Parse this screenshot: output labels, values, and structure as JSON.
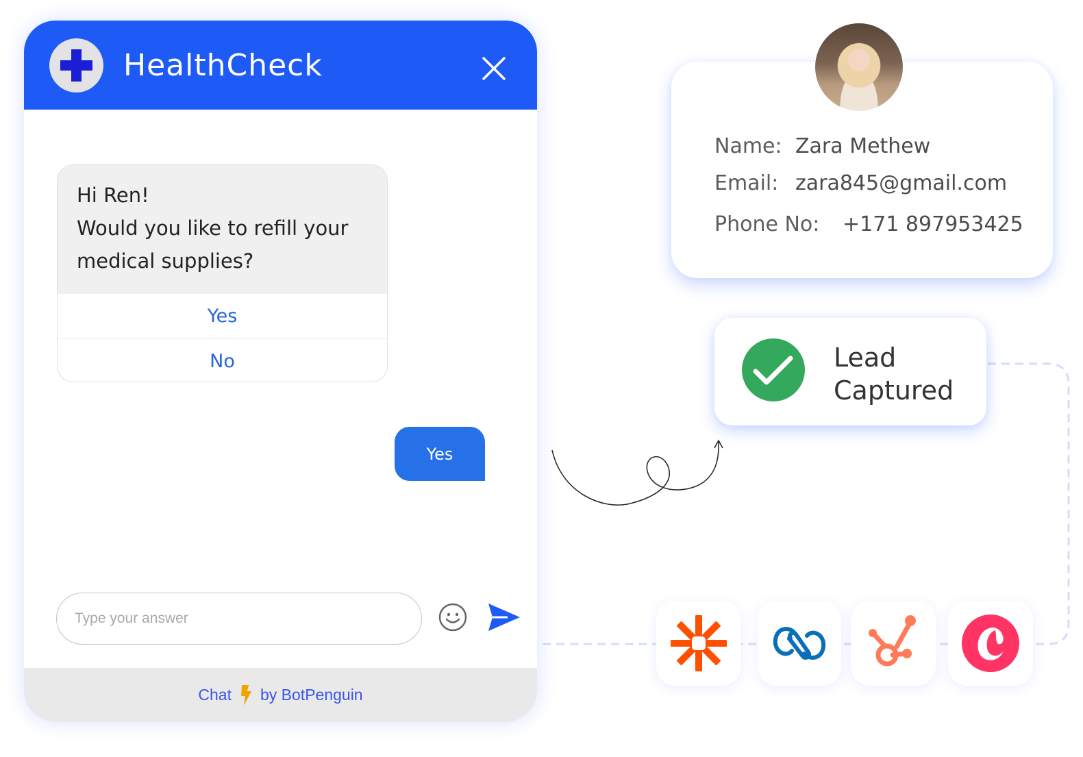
{
  "chat": {
    "title": "HealthCheck",
    "logo_icon": "medical-cross-icon",
    "close_icon": "close-icon",
    "bot_message": {
      "greeting": "Hi Ren!",
      "question": "Would you like to refill your medical supplies?"
    },
    "quick_replies": [
      "Yes",
      "No"
    ],
    "user_reply": "Yes",
    "input": {
      "value": "",
      "placeholder": "Type your answer"
    },
    "emoji_icon": "smiley-icon",
    "send_icon": "send-icon",
    "footer": {
      "prefix": "Chat",
      "icon": "lightning-bolt-icon",
      "suffix": "by BotPenguin"
    }
  },
  "profile": {
    "avatar": "user-photo",
    "fields": [
      {
        "label": "Name:",
        "value": "Zara Methew"
      },
      {
        "label": "Email:",
        "value": "zara845@gmail.com"
      },
      {
        "label": "Phone No:",
        "value": "+171 897953425"
      }
    ]
  },
  "lead_status": {
    "icon": "check-circle-icon",
    "line1": "Lead",
    "line2": "Captured"
  },
  "integrations": [
    {
      "name": "Zapier",
      "icon": "zapier-icon",
      "color": "#ff4f00"
    },
    {
      "name": "Zoho",
      "icon": "zoho-icon",
      "color": "#0a6fb9"
    },
    {
      "name": "HubSpot",
      "icon": "hubspot-icon",
      "color": "#ff7a59"
    },
    {
      "name": "Copper",
      "icon": "copper-icon",
      "color": "#ff3465"
    }
  ],
  "colors": {
    "brand_blue": "#1e5af5",
    "reply_blue": "#2670e8",
    "option_text": "#2663e0",
    "success_green": "#34a85c",
    "footer_text": "#3b55e6",
    "bolt": "#f0a400"
  }
}
